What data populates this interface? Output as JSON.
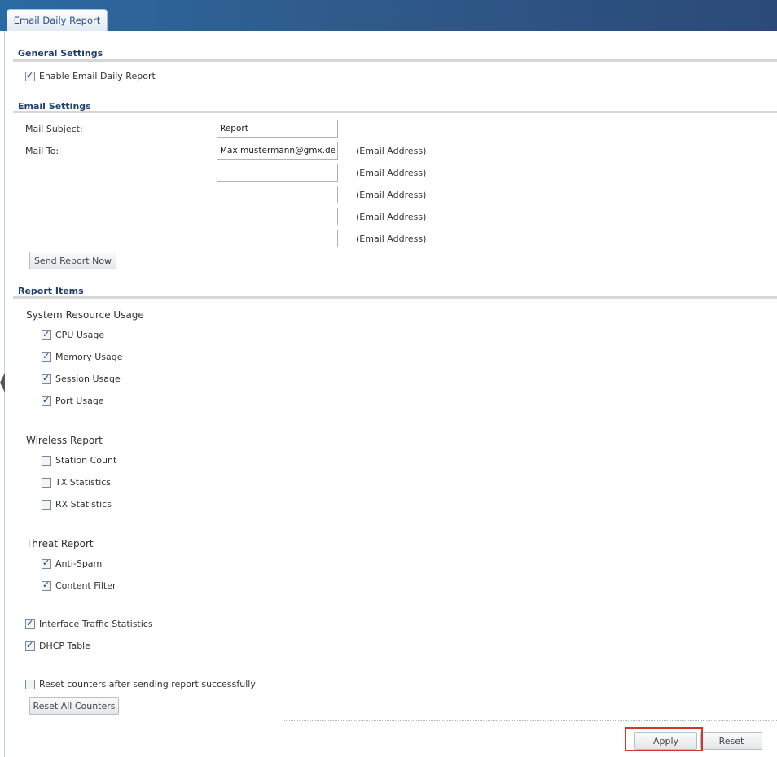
{
  "tab": {
    "label": "Email Daily Report"
  },
  "general": {
    "title": "General Settings",
    "enable_label": "Enable Email Daily Report",
    "enable_checked": true
  },
  "email": {
    "title": "Email Settings",
    "subject_label": "Mail Subject:",
    "subject_value": "Report",
    "mailto_label": "Mail To:",
    "recipients": [
      "Max.mustermann@gmx.de",
      "",
      "",
      "",
      ""
    ],
    "hint": "(Email Address)",
    "send_button": "Send Report Now"
  },
  "report": {
    "title": "Report Items",
    "system": {
      "title": "System Resource Usage",
      "items": [
        {
          "label": "CPU Usage",
          "checked": true
        },
        {
          "label": "Memory Usage",
          "checked": true
        },
        {
          "label": "Session Usage",
          "checked": true
        },
        {
          "label": "Port Usage",
          "checked": true
        }
      ]
    },
    "wireless": {
      "title": "Wireless Report",
      "items": [
        {
          "label": "Station Count",
          "checked": false
        },
        {
          "label": "TX Statistics",
          "checked": false
        },
        {
          "label": "RX Statistics",
          "checked": false
        }
      ]
    },
    "threat": {
      "title": "Threat Report",
      "items": [
        {
          "label": "Anti-Spam",
          "checked": true
        },
        {
          "label": "Content Filter",
          "checked": true
        }
      ]
    },
    "interface_traffic": {
      "label": "Interface Traffic Statistics",
      "checked": true
    },
    "dhcp": {
      "label": "DHCP Table",
      "checked": true
    },
    "reset_after_send": {
      "label": "Reset counters after sending report successfully",
      "checked": false
    },
    "reset_all_button": "Reset All Counters"
  },
  "footer": {
    "apply": "Apply",
    "reset": "Reset"
  }
}
